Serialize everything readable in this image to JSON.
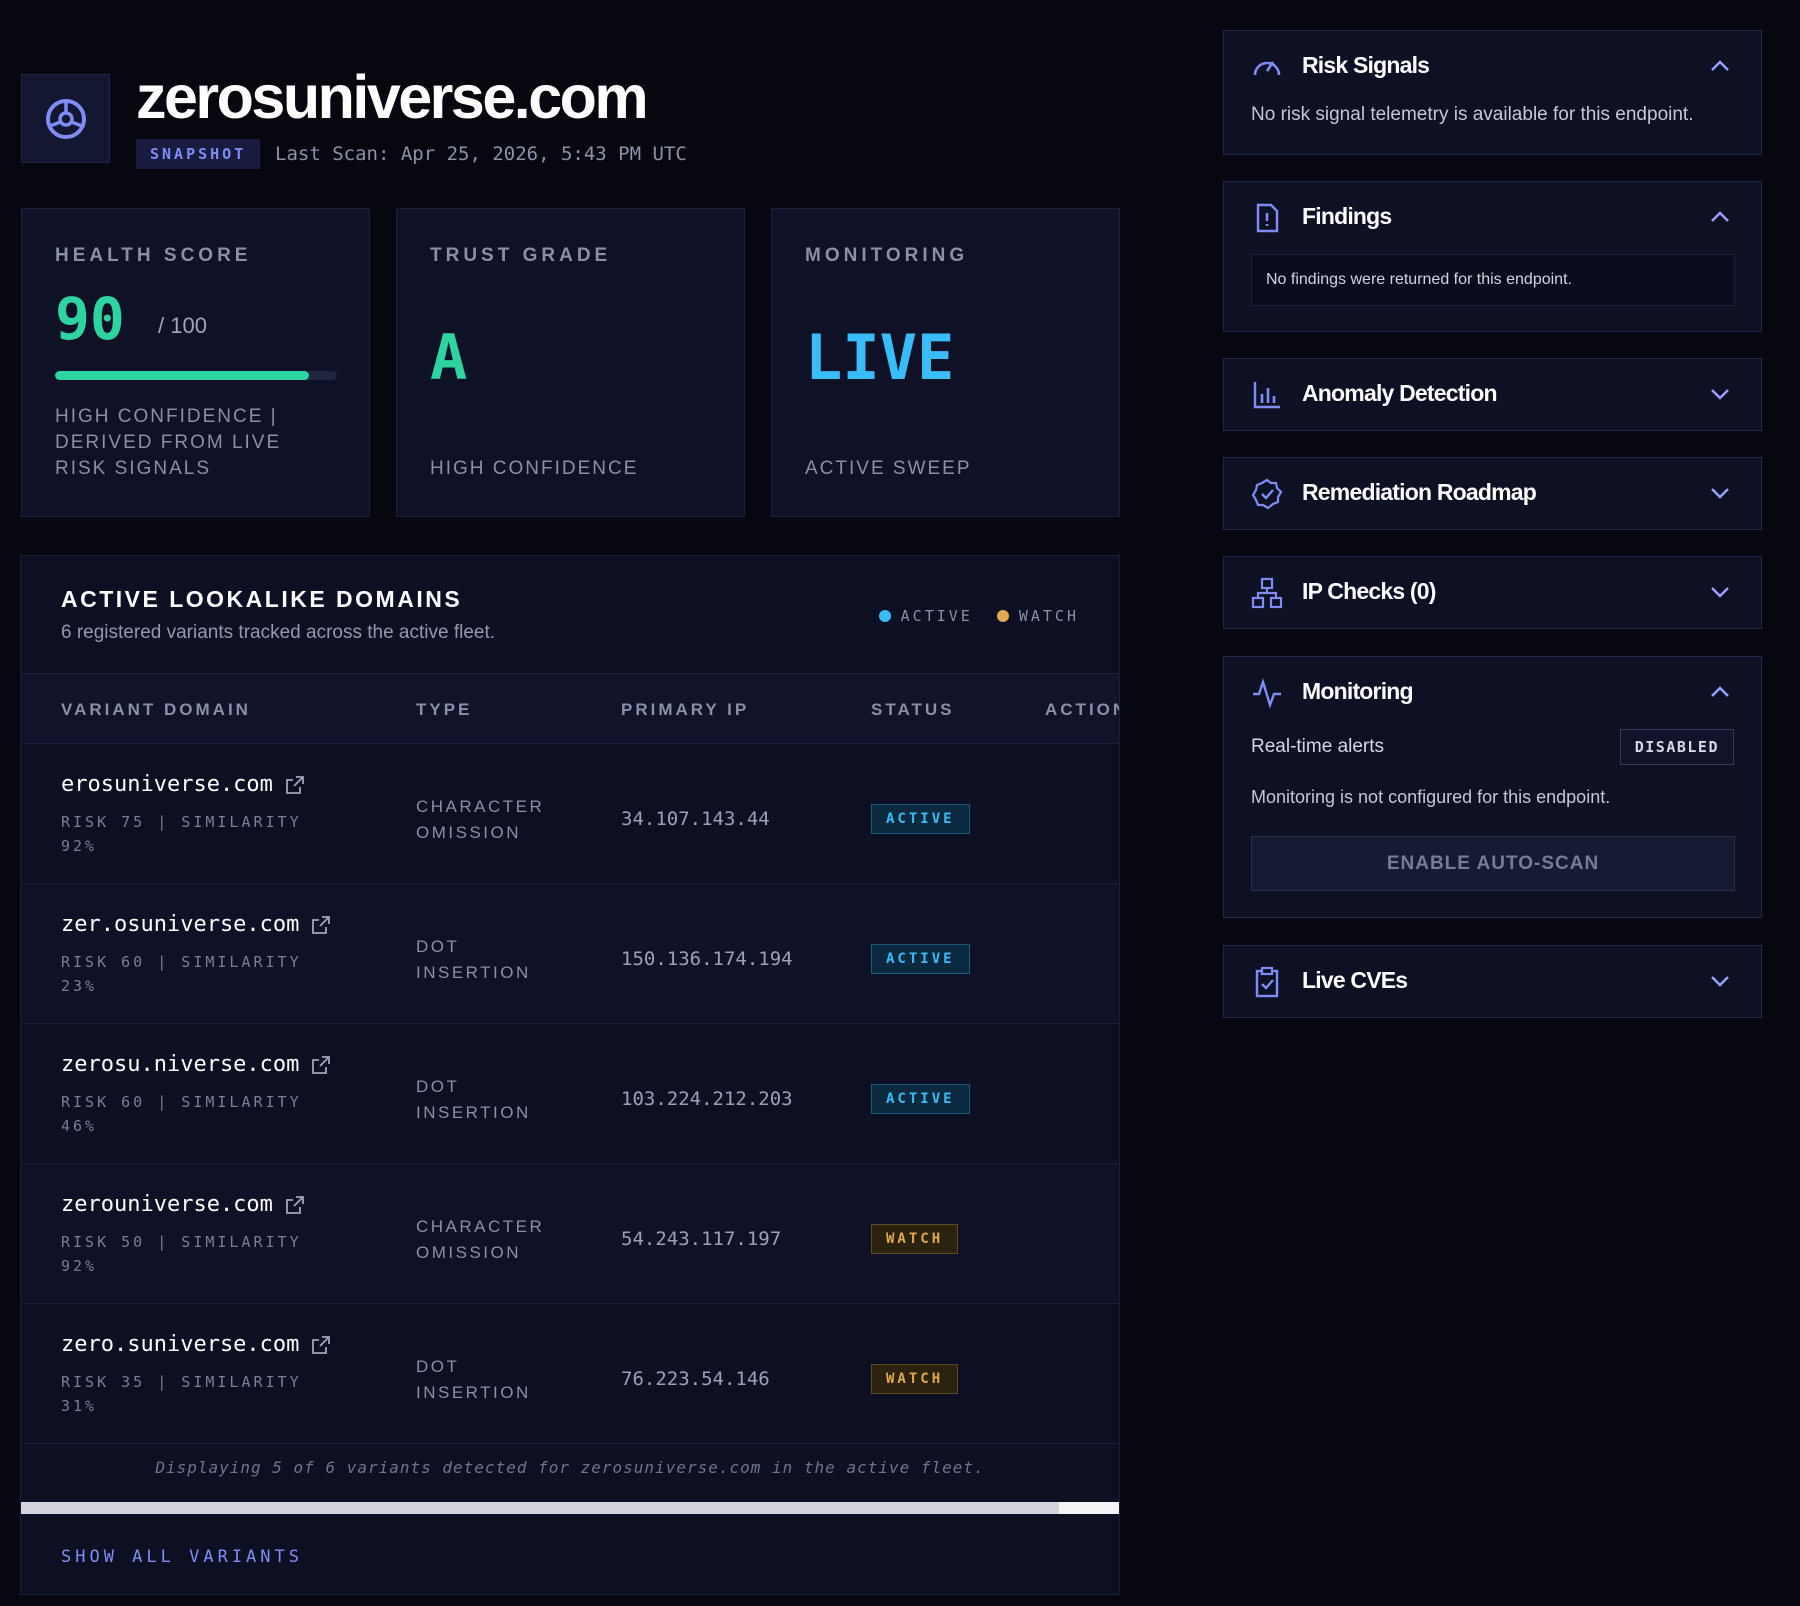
{
  "header": {
    "domain": "zerosuniverse.com",
    "snapshot_label": "SNAPSHOT",
    "last_scan": "Last Scan: Apr 25, 2026, 5:43 PM UTC"
  },
  "metrics": {
    "health": {
      "label": "HEALTH SCORE",
      "value": "90",
      "max": "/ 100",
      "progress": 0.9,
      "foot": "HIGH CONFIDENCE | DERIVED FROM LIVE RISK SIGNALS"
    },
    "trust": {
      "label": "TRUST GRADE",
      "value": "A",
      "foot": "HIGH CONFIDENCE"
    },
    "monitoring": {
      "label": "MONITORING",
      "value": "LIVE",
      "foot": "ACTIVE SWEEP"
    }
  },
  "lookalike": {
    "title": "ACTIVE LOOKALIKE DOMAINS",
    "subtitle": "6 registered variants tracked across the active fleet.",
    "legend": {
      "active": "ACTIVE",
      "watch": "WATCH"
    },
    "columns": {
      "variant": "VARIANT DOMAIN",
      "type": "TYPE",
      "ip": "PRIMARY IP",
      "status": "STATUS",
      "action": "ACTION"
    },
    "rows": [
      {
        "domain": "erosuniverse.com",
        "meta": "RISK 75 | SIMILARITY 92%",
        "type": "CHARACTER OMISSION",
        "ip": "34.107.143.44",
        "status": "ACTIVE",
        "kind": "active"
      },
      {
        "domain": "zer.osuniverse.com",
        "meta": "RISK 60 | SIMILARITY 23%",
        "type": "DOT INSERTION",
        "ip": "150.136.174.194",
        "status": "ACTIVE",
        "kind": "active"
      },
      {
        "domain": "zerosu.niverse.com",
        "meta": "RISK 60 | SIMILARITY 46%",
        "type": "DOT INSERTION",
        "ip": "103.224.212.203",
        "status": "ACTIVE",
        "kind": "active"
      },
      {
        "domain": "zerouniverse.com",
        "meta": "RISK 50 | SIMILARITY 92%",
        "type": "CHARACTER OMISSION",
        "ip": "54.243.117.197",
        "status": "WATCH",
        "kind": "watch"
      },
      {
        "domain": "zero.suniverse.com",
        "meta": "RISK 35 | SIMILARITY 31%",
        "type": "DOT INSERTION",
        "ip": "76.223.54.146",
        "status": "WATCH",
        "kind": "watch"
      }
    ],
    "footnote": "Displaying 5 of 6 variants detected for zerosuniverse.com in the active fleet.",
    "show_all": "SHOW ALL VARIANTS"
  },
  "sidebar": {
    "risk_signals": {
      "title": "Risk Signals",
      "text": "No risk signal telemetry is available for this endpoint."
    },
    "findings": {
      "title": "Findings",
      "text": "No findings were returned for this endpoint."
    },
    "anomaly": {
      "title": "Anomaly Detection"
    },
    "roadmap": {
      "title": "Remediation Roadmap"
    },
    "ip_checks": {
      "title": "IP Checks (0)"
    },
    "monitoring": {
      "title": "Monitoring",
      "alerts_label": "Real-time alerts",
      "alerts_state": "DISABLED",
      "text": "Monitoring is not configured for this endpoint.",
      "button": "ENABLE AUTO-SCAN"
    },
    "cves": {
      "title": "Live CVEs"
    }
  },
  "colors": {
    "accent": "#7f8cf5",
    "health_green": "#2dd4a0",
    "active_blue": "#38bdf8",
    "watch_amber": "#e0a84e"
  }
}
